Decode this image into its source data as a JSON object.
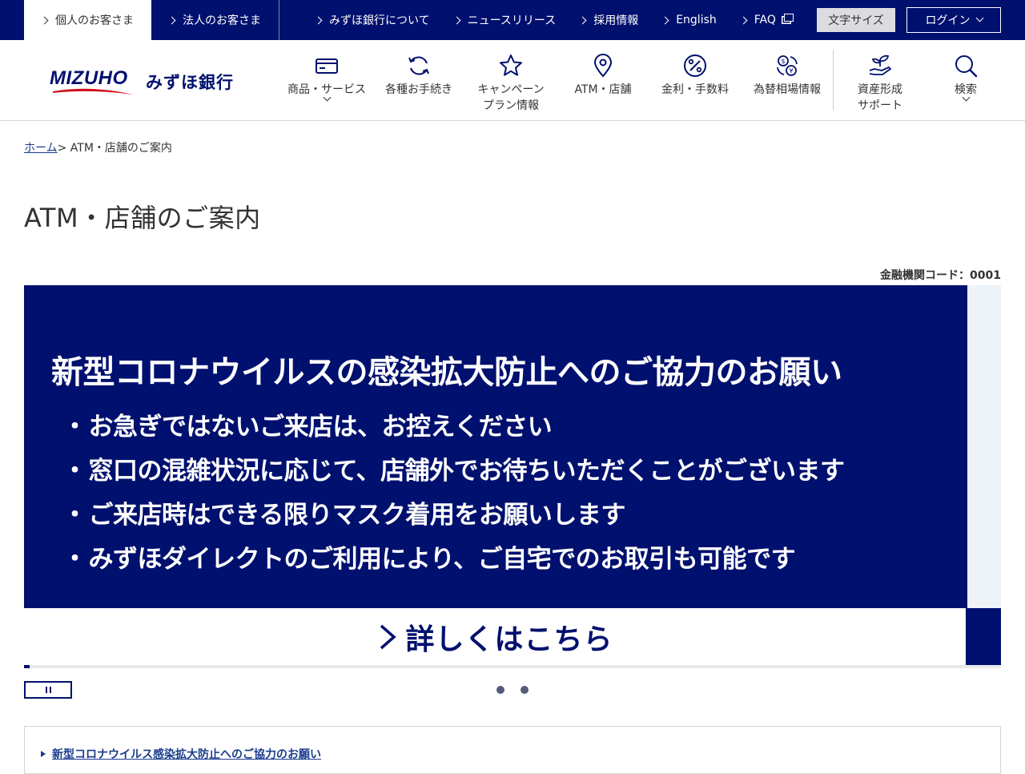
{
  "topbar": {
    "personal": "個人のお客さま",
    "corporate": "法人のお客さま",
    "links": [
      "みずほ銀行について",
      "ニュースリリース",
      "採用情報",
      "English",
      "FAQ"
    ],
    "font_size": "文字サイズ",
    "login": "ログイン"
  },
  "header": {
    "logo_word": "MIZUHO",
    "logo_jp": "みずほ銀行",
    "nav": [
      {
        "line1": "商品・サービス",
        "line2": "",
        "icon": "card-icon"
      },
      {
        "line1": "各種お手続き",
        "line2": "",
        "icon": "refresh-icon"
      },
      {
        "line1": "キャンペーン",
        "line2": "プラン情報",
        "icon": "star-icon"
      },
      {
        "line1": "ATM・店舗",
        "line2": "",
        "icon": "map-pin-icon"
      },
      {
        "line1": "金利・手数料",
        "line2": "",
        "icon": "percent-icon"
      },
      {
        "line1": "為替相場情報",
        "line2": "",
        "icon": "currency-exchange-icon"
      },
      {
        "line1": "資産形成",
        "line2": "サポート",
        "icon": "hand-plant-icon"
      },
      {
        "line1": "検索",
        "line2": "",
        "icon": "search-icon"
      }
    ]
  },
  "breadcrumb": {
    "home": "ホーム",
    "sep": ">",
    "current": "ATM・店舗のご案内"
  },
  "page": {
    "title": "ATM・店舗のご案内",
    "fincode": "金融機関コード：0001"
  },
  "banner": {
    "title": "新型コロナウイルスの感染拡大防止へのご協力のお願い",
    "items": [
      "お急ぎではないご来店は、お控えください",
      "窓口の混雑状況に応じて、店舗外でお待ちいただくことがございます",
      "ご来店時はできる限りマスク着用をお願いします",
      "みずほダイレクトのご利用により、ご自宅でのお取引も可能です"
    ],
    "cta": "詳しくはこちら"
  },
  "carousel": {
    "slides": 2,
    "active": 1
  },
  "notice": {
    "link": "新型コロナウイルス感染拡大防止へのご協力のお願い"
  },
  "colors": {
    "brand_navy": "#00106e",
    "link_blue": "#1a3c8c",
    "logo_red": "#d0111b"
  }
}
